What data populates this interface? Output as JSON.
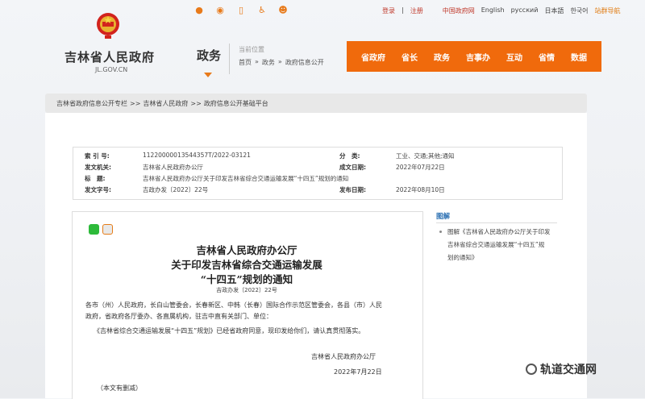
{
  "header": {
    "site_name": "吉林省人民政府",
    "site_domain": "JL.GOV.CN",
    "section": "政务",
    "location_label": "当前位置",
    "location_path": [
      "首页",
      "»",
      "政务",
      "»",
      "政府信息公开"
    ],
    "top_links": {
      "login": "登录",
      "sep": "|",
      "register": "注册",
      "china_gov": "中国政府网",
      "english": "English",
      "russian": "русский",
      "japanese": "日本語",
      "korean": "한국어",
      "accessibility": "站群导航"
    },
    "nav": [
      "省政府",
      "省长",
      "政务",
      "吉事办",
      "互动",
      "省情",
      "数据"
    ],
    "icons": [
      "wechat-icon",
      "weibo-icon",
      "mobile-icon",
      "accessibility-icon",
      "mascot-icon"
    ]
  },
  "breadcrumb": [
    "吉林省政府信息公开专栏",
    ">>",
    "吉林省人民政府",
    ">>",
    "政府信息公开基础平台"
  ],
  "meta": {
    "index_k": "索 引 号:",
    "index_v": "11220000013544357T/2022-03121",
    "category_k": "分　类:",
    "category_v": "工业、交通;其他;通知",
    "issuer_k": "发文机关:",
    "issuer_v": "吉林省人民政府办公厅",
    "date_k": "成文日期:",
    "date_v": "2022年07月22日",
    "title_k": "标　题:",
    "title_v": "吉林省人民政府办公厅关于印发吉林省综合交通运输发展“十四五”规划的通知",
    "number_k": "发文字号:",
    "number_v": "吉政办发〔2022〕22号",
    "pubdate_k": "发布日期:",
    "pubdate_v": "2022年08月10日"
  },
  "doc": {
    "title1": "吉林省人民政府办公厅",
    "title2": "关于印发吉林省综合交通运输发展",
    "title3": "“十四五”规划的通知",
    "doc_number": "吉政办发〔2022〕22号",
    "p1": "各市（州）人民政府，长白山管委会，长春新区、中韩（长春）国际合作示范区管委会，各县（市）人民",
    "p2": "政府，省政府各厅委办、各直属机构，驻吉中直有关部门、单位：",
    "p3": "《吉林省综合交通运输发展“十四五”规划》已经省政府同意，现印发给你们，请认真贯彻落实。",
    "sig_org": "吉林省人民政府办公厅",
    "sig_date": "2022年7月22日",
    "note": "（本文有删减）"
  },
  "side": {
    "title": "图解",
    "link1": "图解《吉林省人民政府办公厅关于印发",
    "link2": "吉林省综合交通运输发展“十四五”规",
    "link3": "划的通知》"
  },
  "watermark": "轨道交通网",
  "colors": {
    "accent": "#f06a0c",
    "link_blue": "#2a6fb2",
    "red": "#c0392b"
  }
}
